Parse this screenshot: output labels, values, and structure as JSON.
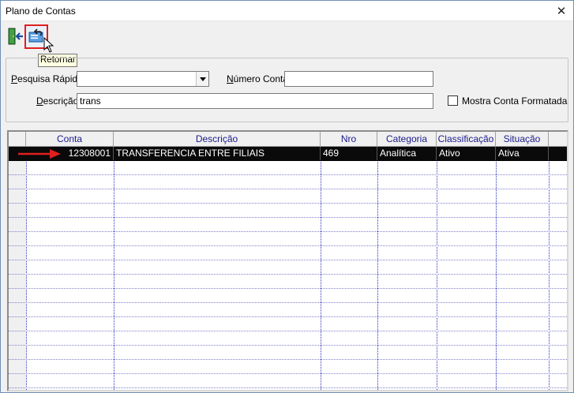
{
  "window": {
    "title": "Plano de Contas",
    "close_glyph": "✕"
  },
  "toolbar": {
    "exit_icon": "exit-door-icon",
    "return_icon": "return-card-icon",
    "tooltip": "Retornar"
  },
  "filters": {
    "quick_search_label_accel": "P",
    "quick_search_label_rest": "esquisa Rápida",
    "quick_search_value": "",
    "account_number_label_accel": "N",
    "account_number_label_rest": "úmero Conta",
    "account_number_value": "",
    "description_label_accel": "D",
    "description_label_rest": "escrição",
    "description_value": "trans",
    "formatted_checkbox_label": "Mostra Conta Formatada",
    "formatted_checked": false
  },
  "grid": {
    "columns": [
      "Conta",
      "Descrição",
      "Nro Reduzido",
      "Categoria",
      "Classificação",
      "Situação"
    ],
    "rows": [
      {
        "conta": "12308001",
        "descricao": "TRANSFERENCIA ENTRE FILIAIS",
        "nro_reduzido": "469",
        "categoria": "Analítica",
        "classificacao": "Ativo",
        "situacao": "Ativa",
        "selected": true
      }
    ],
    "arrow_color": "#e01f1f"
  }
}
